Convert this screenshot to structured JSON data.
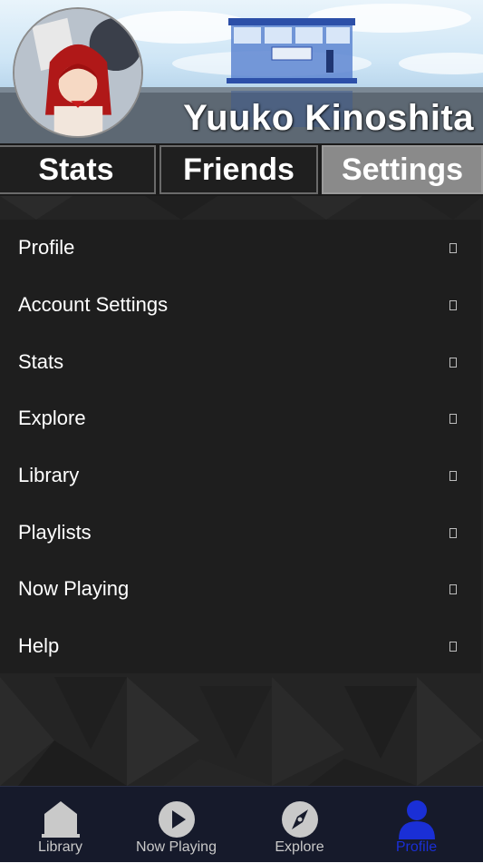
{
  "profile": {
    "username": "Yuuko Kinoshita"
  },
  "tabs": [
    {
      "label": "Stats",
      "active": false
    },
    {
      "label": "Friends",
      "active": false
    },
    {
      "label": "Settings",
      "active": true
    }
  ],
  "menu": {
    "items": [
      {
        "label": "Profile",
        "icon": "chevron-right-icon"
      },
      {
        "label": "Account Settings",
        "icon": "chevron-right-icon"
      },
      {
        "label": "Stats",
        "icon": "chevron-right-icon"
      },
      {
        "label": "Explore",
        "icon": "chevron-right-icon"
      },
      {
        "label": "Library",
        "icon": "chevron-right-icon"
      },
      {
        "label": "Playlists",
        "icon": "chevron-right-icon"
      },
      {
        "label": "Now Playing",
        "icon": "chevron-right-icon"
      },
      {
        "label": "Help",
        "icon": "chevron-right-icon"
      }
    ]
  },
  "bottom_nav": {
    "items": [
      {
        "label": "Library",
        "icon": "library-icon",
        "active": false
      },
      {
        "label": "Now Playing",
        "icon": "play-icon",
        "active": false
      },
      {
        "label": "Explore",
        "icon": "compass-icon",
        "active": false
      },
      {
        "label": "Profile",
        "icon": "user-icon",
        "active": true
      }
    ]
  },
  "colors": {
    "accent": "#1a2fd6",
    "panel": "#1e1e1e",
    "nav_bg": "#161a2b",
    "active_tab": "#8a8a8a"
  }
}
